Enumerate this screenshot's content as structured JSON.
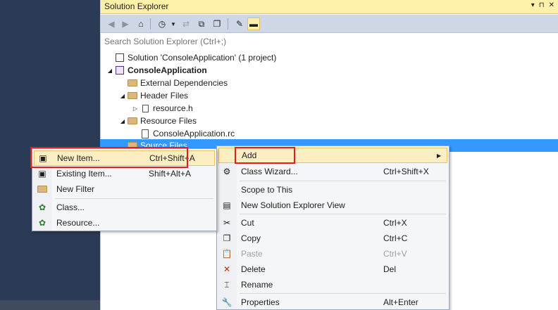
{
  "solution_explorer": {
    "title": "Solution Explorer",
    "title_buttons": [
      "▾",
      "⊓",
      "✕"
    ],
    "search_placeholder": "Search Solution Explorer (Ctrl+;)",
    "tree": [
      {
        "label": "Solution 'ConsoleApplication' (1 project)",
        "icon": "solution-icon",
        "bold": false
      },
      {
        "label": "ConsoleApplication",
        "icon": "project-icon",
        "bold": true
      },
      {
        "label": "External Dependencies",
        "icon": "folder-icon"
      },
      {
        "label": "Header Files",
        "icon": "folder-icon"
      },
      {
        "label": "resource.h",
        "icon": "header-file-icon"
      },
      {
        "label": "Resource Files",
        "icon": "folder-icon"
      },
      {
        "label": "ConsoleApplication.rc",
        "icon": "rc-file-icon"
      },
      {
        "label": "Source Files",
        "icon": "folder-icon"
      }
    ]
  },
  "context_menu": {
    "items": [
      {
        "label": "Add",
        "shortcut": "",
        "icon": "",
        "submenu": true
      },
      {
        "label": "Class Wizard...",
        "shortcut": "Ctrl+Shift+X",
        "icon": "class-wizard-icon"
      },
      {
        "label": "Scope to This",
        "shortcut": "",
        "icon": ""
      },
      {
        "label": "New Solution Explorer View",
        "shortcut": "",
        "icon": "new-view-icon"
      },
      {
        "label": "Cut",
        "shortcut": "Ctrl+X",
        "icon": "cut-icon"
      },
      {
        "label": "Copy",
        "shortcut": "Ctrl+C",
        "icon": "copy-icon"
      },
      {
        "label": "Paste",
        "shortcut": "Ctrl+V",
        "icon": "paste-icon",
        "disabled": true
      },
      {
        "label": "Delete",
        "shortcut": "Del",
        "icon": "delete-icon"
      },
      {
        "label": "Rename",
        "shortcut": "",
        "icon": "rename-icon"
      },
      {
        "label": "Properties",
        "shortcut": "Alt+Enter",
        "icon": "wrench-icon"
      }
    ]
  },
  "add_submenu": {
    "items": [
      {
        "label": "New Item...",
        "shortcut": "Ctrl+Shift+A",
        "icon": "new-item-icon"
      },
      {
        "label": "Existing Item...",
        "shortcut": "Shift+Alt+A",
        "icon": "existing-item-icon"
      },
      {
        "label": "New Filter",
        "shortcut": "",
        "icon": "new-filter-icon"
      },
      {
        "label": "Class...",
        "shortcut": "",
        "icon": "class-icon"
      },
      {
        "label": "Resource...",
        "shortcut": "",
        "icon": "resource-icon"
      }
    ]
  },
  "colors": {
    "selection": "#3399ff",
    "highlight": "#fbeec2",
    "annotation_red": "#e02020",
    "title_bar": "#fff1a8"
  }
}
